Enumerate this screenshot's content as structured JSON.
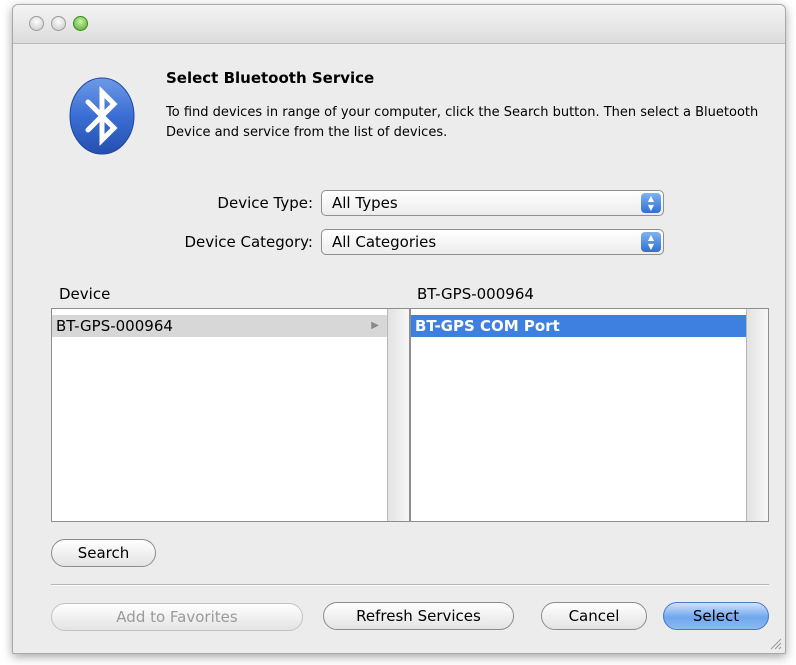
{
  "dialog": {
    "title": "Select Bluetooth Service",
    "description": "To find devices in range of your computer, click the Search button. Then select a Bluetooth Device and service from the list of devices."
  },
  "filters": {
    "device_type_label": "Device Type:",
    "device_type_value": "All Types",
    "device_category_label": "Device Category:",
    "device_category_value": "All Categories"
  },
  "device_list": {
    "header": "Device",
    "items": [
      "BT-GPS-000964"
    ]
  },
  "service_list": {
    "header": "BT-GPS-000964",
    "items": [
      "BT-GPS COM Port"
    ]
  },
  "buttons": {
    "search": "Search",
    "add_to_favorites": "Add to Favorites",
    "refresh_services": "Refresh Services",
    "cancel": "Cancel",
    "select": "Select"
  },
  "colors": {
    "bluetooth_blue": "#2f63c8",
    "selection_blue": "#3d80df",
    "default_button": "#6fa7ee"
  },
  "icons": [
    "bluetooth-icon",
    "popup-arrows-icon",
    "disclosure-arrow-icon",
    "resize-grip-icon"
  ]
}
